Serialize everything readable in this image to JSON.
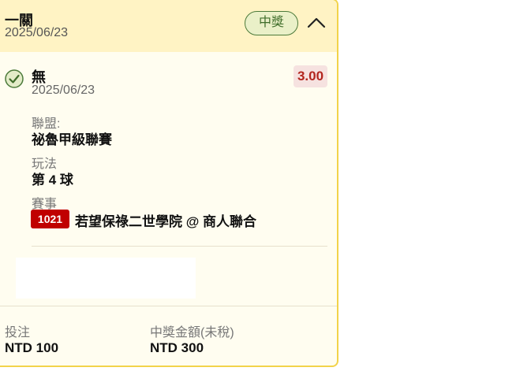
{
  "header": {
    "bet_type": "一關",
    "date": "2025/06/23",
    "status": "中獎"
  },
  "selection": {
    "name": "無",
    "date": "2025/06/23",
    "odds": "3.00",
    "league_label": "聯盟:",
    "league_value": "祕魯甲級聯賽",
    "market_label": "玩法",
    "market_value": "第 4 球",
    "event_label": "賽事",
    "event_id": "1021",
    "event_name": "若望保祿二世學院 @ 商人聯合"
  },
  "footer": {
    "stake_label": "投注",
    "stake_value": "NTD 100",
    "payout_label": "中獎金額(未稅)",
    "payout_value": "NTD 300"
  },
  "colors": {
    "border": "#f2d34a",
    "header_bg": "#fff3c4",
    "win_badge": "#4c7a3a",
    "odds_text": "#b3261e",
    "match_id_bg": "#c00000"
  },
  "icons": {
    "status_check": "check-circle-icon",
    "collapse": "chevron-up-icon"
  }
}
